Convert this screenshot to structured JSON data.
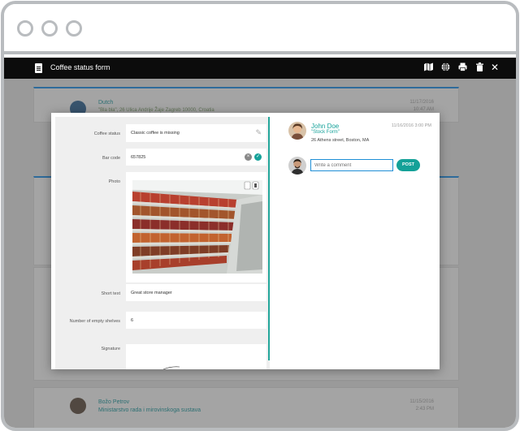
{
  "app": {
    "title": "Coffee status form"
  },
  "toolbar_icons": [
    "map-icon",
    "globe-icon",
    "print-icon",
    "trash-icon",
    "close-icon"
  ],
  "background_cards": [
    {
      "name": "Dutch",
      "address": "\"Bla bla\", 26 Ulica Andrije Žaje Zagreb 10000, Croatia",
      "date": "11/17/2016",
      "time": "10:47 AM"
    },
    {
      "name": "Božo Petrov",
      "address": "Ministarstvo rada i mirovinskoga sustava",
      "date": "11/15/2016",
      "time": "2:43 PM"
    }
  ],
  "form": {
    "coffee_status": {
      "label": "Coffee status",
      "value": "Classic coffee is missing"
    },
    "bar_code": {
      "label": "Bar code",
      "value": "657825"
    },
    "photo": {
      "label": "Photo"
    },
    "short_text": {
      "label": "Short text",
      "value": "Great store manager"
    },
    "empty_shelves": {
      "label": "Number of empty shelves",
      "value": "6"
    },
    "signature": {
      "label": "Signature"
    }
  },
  "comment": {
    "author": "John Doe",
    "form_tag": "\"Stock Form\"",
    "address": "26 Athens street, Boston, MA",
    "timestamp": "11/16/2016 3:00 PM",
    "input_placeholder": "Write a comment",
    "post_label": "POST"
  },
  "colors": {
    "accent": "#14a198",
    "app_bar": "#0c0c0c",
    "link_blue": "#1f8fd6"
  }
}
